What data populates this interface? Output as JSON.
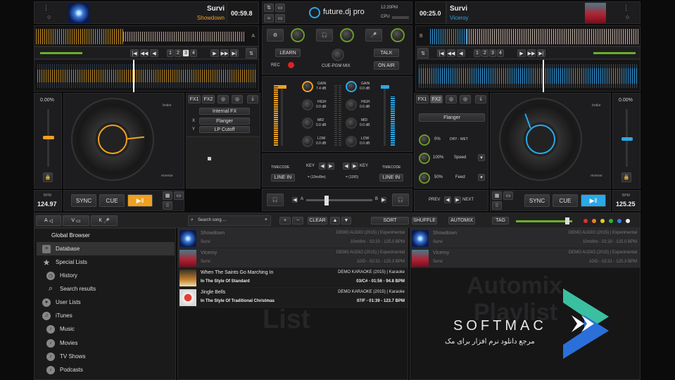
{
  "deck_left": {
    "artist": "Survi",
    "title": "Showdown",
    "time": "00:59.8",
    "deck_letter": "A",
    "pitch": "0.00%",
    "bpm_label": "BPM",
    "bpm": "124.97",
    "sync": "SYNC",
    "cue": "CUE",
    "brake": "brake",
    "reverse": "reverse",
    "fx_tabs": [
      "FX1",
      "FX2"
    ],
    "fx_source": "Internal FX",
    "fx_x_label": "X",
    "fx_x": "Flanger",
    "fx_y_label": "Y",
    "fx_y": "LP Cutoff",
    "loop_nums": [
      "1",
      "2",
      "3",
      "4"
    ]
  },
  "deck_right": {
    "artist": "Survi",
    "title": "Viceroy",
    "time": "00:25.0",
    "deck_letter": "B",
    "pitch": "0.00%",
    "bpm_label": "BPM",
    "bpm": "125.25",
    "sync": "SYNC",
    "cue": "CUE",
    "brake": "brake",
    "reverse": "reverse",
    "fx_tabs": [
      "FX1",
      "FX2"
    ],
    "fx_effect": "Flanger",
    "dry_value": "0%",
    "dry_label": "DRY - WET",
    "speed_value": "100%",
    "speed_label": "Speed",
    "feed_value": "50%",
    "feed_label": "Feed",
    "loop_nums": [
      "1",
      "2",
      "3",
      "4"
    ],
    "prev": "PREV",
    "next": "NEXT"
  },
  "top_center": {
    "brand": "future.dj pro",
    "clock": "12:20PM",
    "cpu": "CPU"
  },
  "mixer": {
    "learn": "LEARN",
    "rec": "REC",
    "cue_pgm": "CUE-PGM MIX",
    "talk": "TALK",
    "on_air": "ON AIR",
    "gain": "GAIN",
    "gain_val_l": "7.4 dB",
    "gain_val_r": "0.0 dB",
    "high": "HIGH",
    "mid": "MID",
    "low": "LOW",
    "zero_db": "0.0 dB",
    "timecode": "TIMECODE",
    "line_in": "LINE IN",
    "key": "KEY",
    "key_val_l": "= (10m/8m)",
    "key_val_r": "= (10/D)",
    "cross_a": "A",
    "cross_b": "B"
  },
  "browser_bar": {
    "search_placeholder": "Search song ...",
    "clear": "CLEAR",
    "sort": "SORT",
    "shuffle": "SHUFFLE",
    "automix": "AUTOMIX",
    "tag": "TAG",
    "tab_a": "A",
    "tab_v": "V",
    "tab_k": "K"
  },
  "sidebar": {
    "header": "Global Browser",
    "items": [
      {
        "label": "Database",
        "icon": "database-icon"
      },
      {
        "label": "Special Lists",
        "icon": "star-icon"
      },
      {
        "label": "History",
        "icon": "history-icon"
      },
      {
        "label": "Search results",
        "icon": "search-icon"
      },
      {
        "label": "User Lists",
        "icon": "user-icon"
      },
      {
        "label": "iTunes",
        "icon": "itunes-icon"
      },
      {
        "label": "Music",
        "icon": "music-icon"
      },
      {
        "label": "Movies",
        "icon": "movies-icon"
      },
      {
        "label": "TV Shows",
        "icon": "tv-icon"
      },
      {
        "label": "Podcasts",
        "icon": "podcast-icon"
      }
    ]
  },
  "song_list": [
    {
      "title": "Showdown",
      "artist": "Survi",
      "album": "DEMO AUDIO (2015) | Experimental",
      "info": "10m/8m - 02:20 - 125.0 BPM"
    },
    {
      "title": "Viceroy",
      "artist": "Survi",
      "album": "DEMO AUDIO (2015) | Experimental",
      "info": "10/D - 02:31 - 125.3 BPM"
    },
    {
      "title": "When The Saints Go Marching In",
      "artist": "In The Style Of Standard",
      "album": "DEMO KARAOKE (2015) | Karaoke",
      "info": "03/C# - 01:56 - 94.8 BPM"
    },
    {
      "title": "Jingle Bells",
      "artist": "In The Style Of Traditional Christmas",
      "album": "DEMO KARAOKE (2015) | Karaoke",
      "info": "07/F - 01:39 - 123.7 BPM"
    }
  ],
  "list_watermark": "List",
  "automix_list": [
    {
      "title": "Showdown",
      "artist": "Survi",
      "album": "DEMO AUDIO (2015) | Experimental",
      "info": "10m/8m - 02:20 - 125.0 BPM"
    },
    {
      "title": "Viceroy",
      "artist": "Survi",
      "album": "DEMO AUDIO (2015) | Experimental",
      "info": "10/D - 02:31 - 125.3 BPM"
    }
  ],
  "automix_watermark": [
    "Automix",
    "Playlist"
  ],
  "watermark": {
    "brand": "SOFTMAC",
    "tagline": "مرجع دانلود نرم افزار برای مک"
  },
  "colors": {
    "left_accent": "#f0a020",
    "right_accent": "#2aa8e8"
  }
}
